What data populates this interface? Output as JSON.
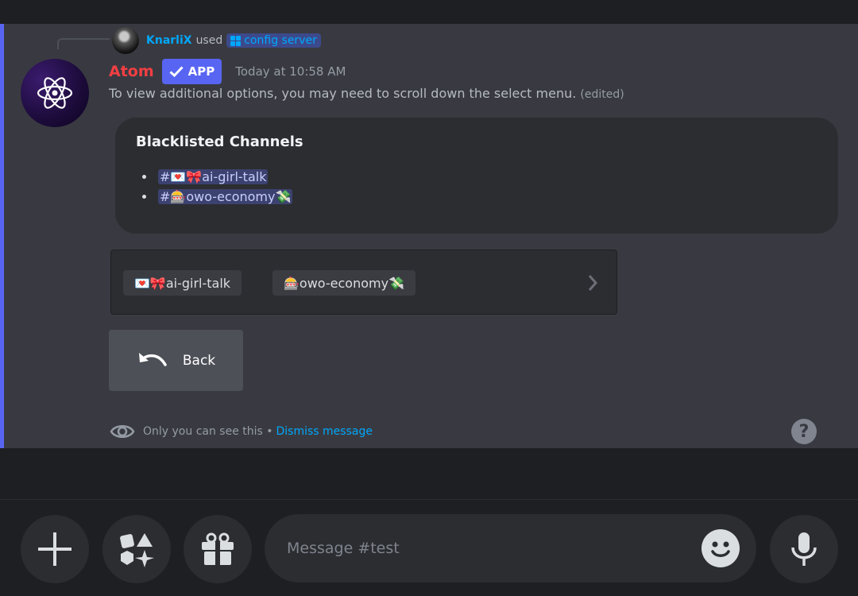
{
  "command": {
    "user": "KnarliX",
    "used_text": "used",
    "command_name": "config server"
  },
  "bot": {
    "name": "Atom",
    "badge": "APP",
    "timestamp": "Today at 10:58 AM"
  },
  "message": {
    "text": "To view additional options, you may need to scroll down the select menu.",
    "edited": "(edited)"
  },
  "embed": {
    "title": "Blacklisted Channels",
    "channels": [
      "#💌🎀ai-girl-talk",
      "#🎰owo-economy💸"
    ]
  },
  "select_menu": {
    "chips": [
      "💌🎀ai-girl-talk",
      "🎰owo-economy💸"
    ]
  },
  "back_button": {
    "label": "Back"
  },
  "ephemeral": {
    "text": "Only you can see this •",
    "dismiss": "Dismiss message"
  },
  "composer": {
    "placeholder": "Message #test"
  },
  "colors": {
    "accent": "#5865f2",
    "bot_name": "#f23f43",
    "link": "#00a8fc"
  }
}
